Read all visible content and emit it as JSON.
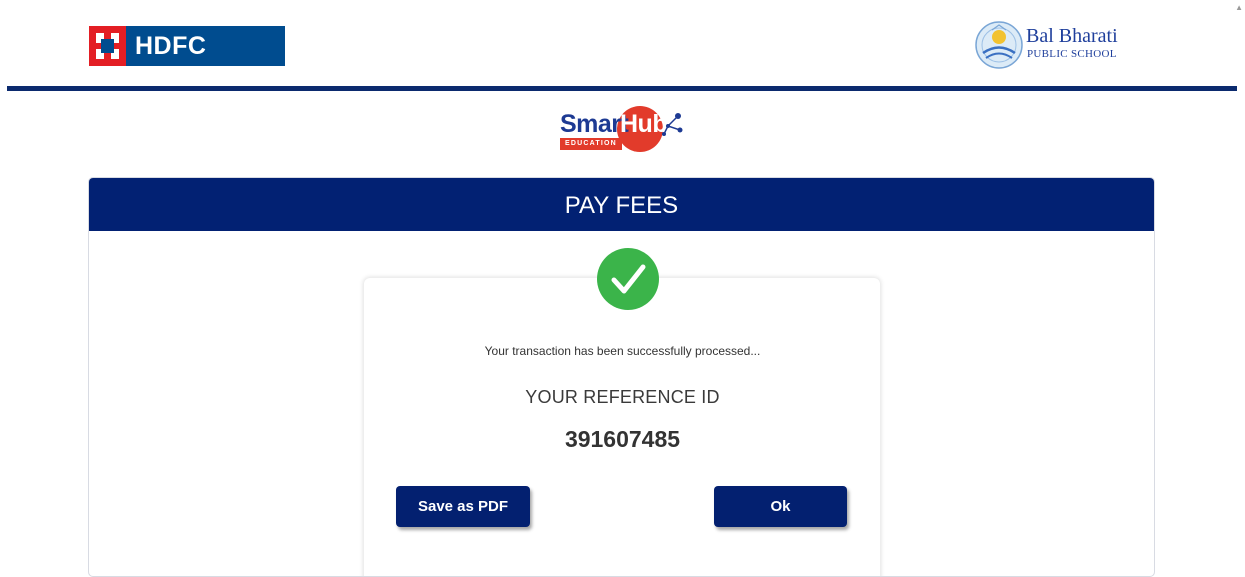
{
  "header": {
    "bank_logo_text": "HDFC BANK",
    "school_name": "Bal Bharati",
    "school_subtitle": "PUBLIC SCHOOL"
  },
  "smarthub": {
    "smart": "Smart",
    "hub": "Hub",
    "edu": "EDUCATION"
  },
  "panel": {
    "title": "PAY FEES",
    "status_icon": "check-icon",
    "message": "Your transaction has been successfully processed...",
    "reference_label": "YOUR REFERENCE ID",
    "reference_id": "391607485",
    "save_pdf_label": "Save as PDF",
    "ok_label": "Ok"
  },
  "colors": {
    "brand_navy": "#022173",
    "success_green": "#3bb44a",
    "hdfc_red": "#e31e24",
    "hdfc_blue": "#004c8f"
  }
}
